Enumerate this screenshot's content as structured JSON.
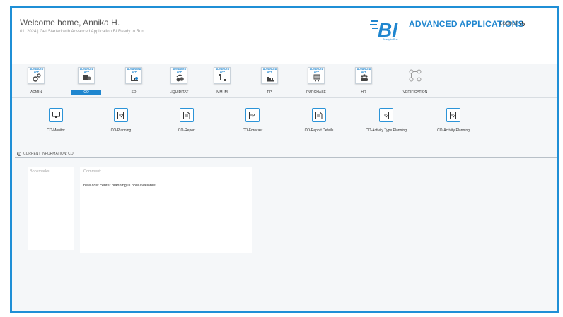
{
  "header": {
    "welcome": "Welcome home, Annika H.",
    "subline": "01, 2024 | Get Started with Advanced Application BI Ready to Run",
    "logo_text": "BI",
    "logo_sub": "Ready to Run",
    "brand": "ADVANCED APPLICATIONS",
    "logout_label": "LOGOUT"
  },
  "apps": {
    "badge": "ADVANCED APP",
    "items": [
      {
        "label": "ADMIN",
        "icon": "gears-icon"
      },
      {
        "label": "CO",
        "icon": "coins-icon",
        "active": true
      },
      {
        "label": "SD",
        "icon": "factory-icon"
      },
      {
        "label": "LIQUIDITAT",
        "icon": "money-icon"
      },
      {
        "label": "MM-IM",
        "icon": "network-icon"
      },
      {
        "label": "PP",
        "icon": "production-icon"
      },
      {
        "label": "PURCHASE",
        "icon": "cart-icon"
      },
      {
        "label": "HR",
        "icon": "people-icon"
      },
      {
        "label": "VERIFICATION",
        "icon": "flow-icon"
      }
    ]
  },
  "modules": [
    {
      "label": "CO-Monitor",
      "icon": "monitor-icon"
    },
    {
      "label": "CO-Planning",
      "icon": "edit-doc-icon"
    },
    {
      "label": "CO-Report",
      "icon": "doc-icon"
    },
    {
      "label": "CO-Forecast",
      "icon": "edit-doc-icon"
    },
    {
      "label": "CO-Report Details",
      "icon": "doc-icon"
    },
    {
      "label": "CO-Activity Type Planning",
      "icon": "edit-doc-icon"
    },
    {
      "label": "CO-Activity Planning",
      "icon": "edit-doc-icon"
    }
  ],
  "info": {
    "label": "CURRENT INFORMATION: CO"
  },
  "bookmarks": {
    "title": "Bookmarks:"
  },
  "comment": {
    "title": "Comment:",
    "text": "new cost center planning is now available!"
  },
  "colors": {
    "accent": "#1f86cf",
    "frame": "#1f8fd6"
  }
}
